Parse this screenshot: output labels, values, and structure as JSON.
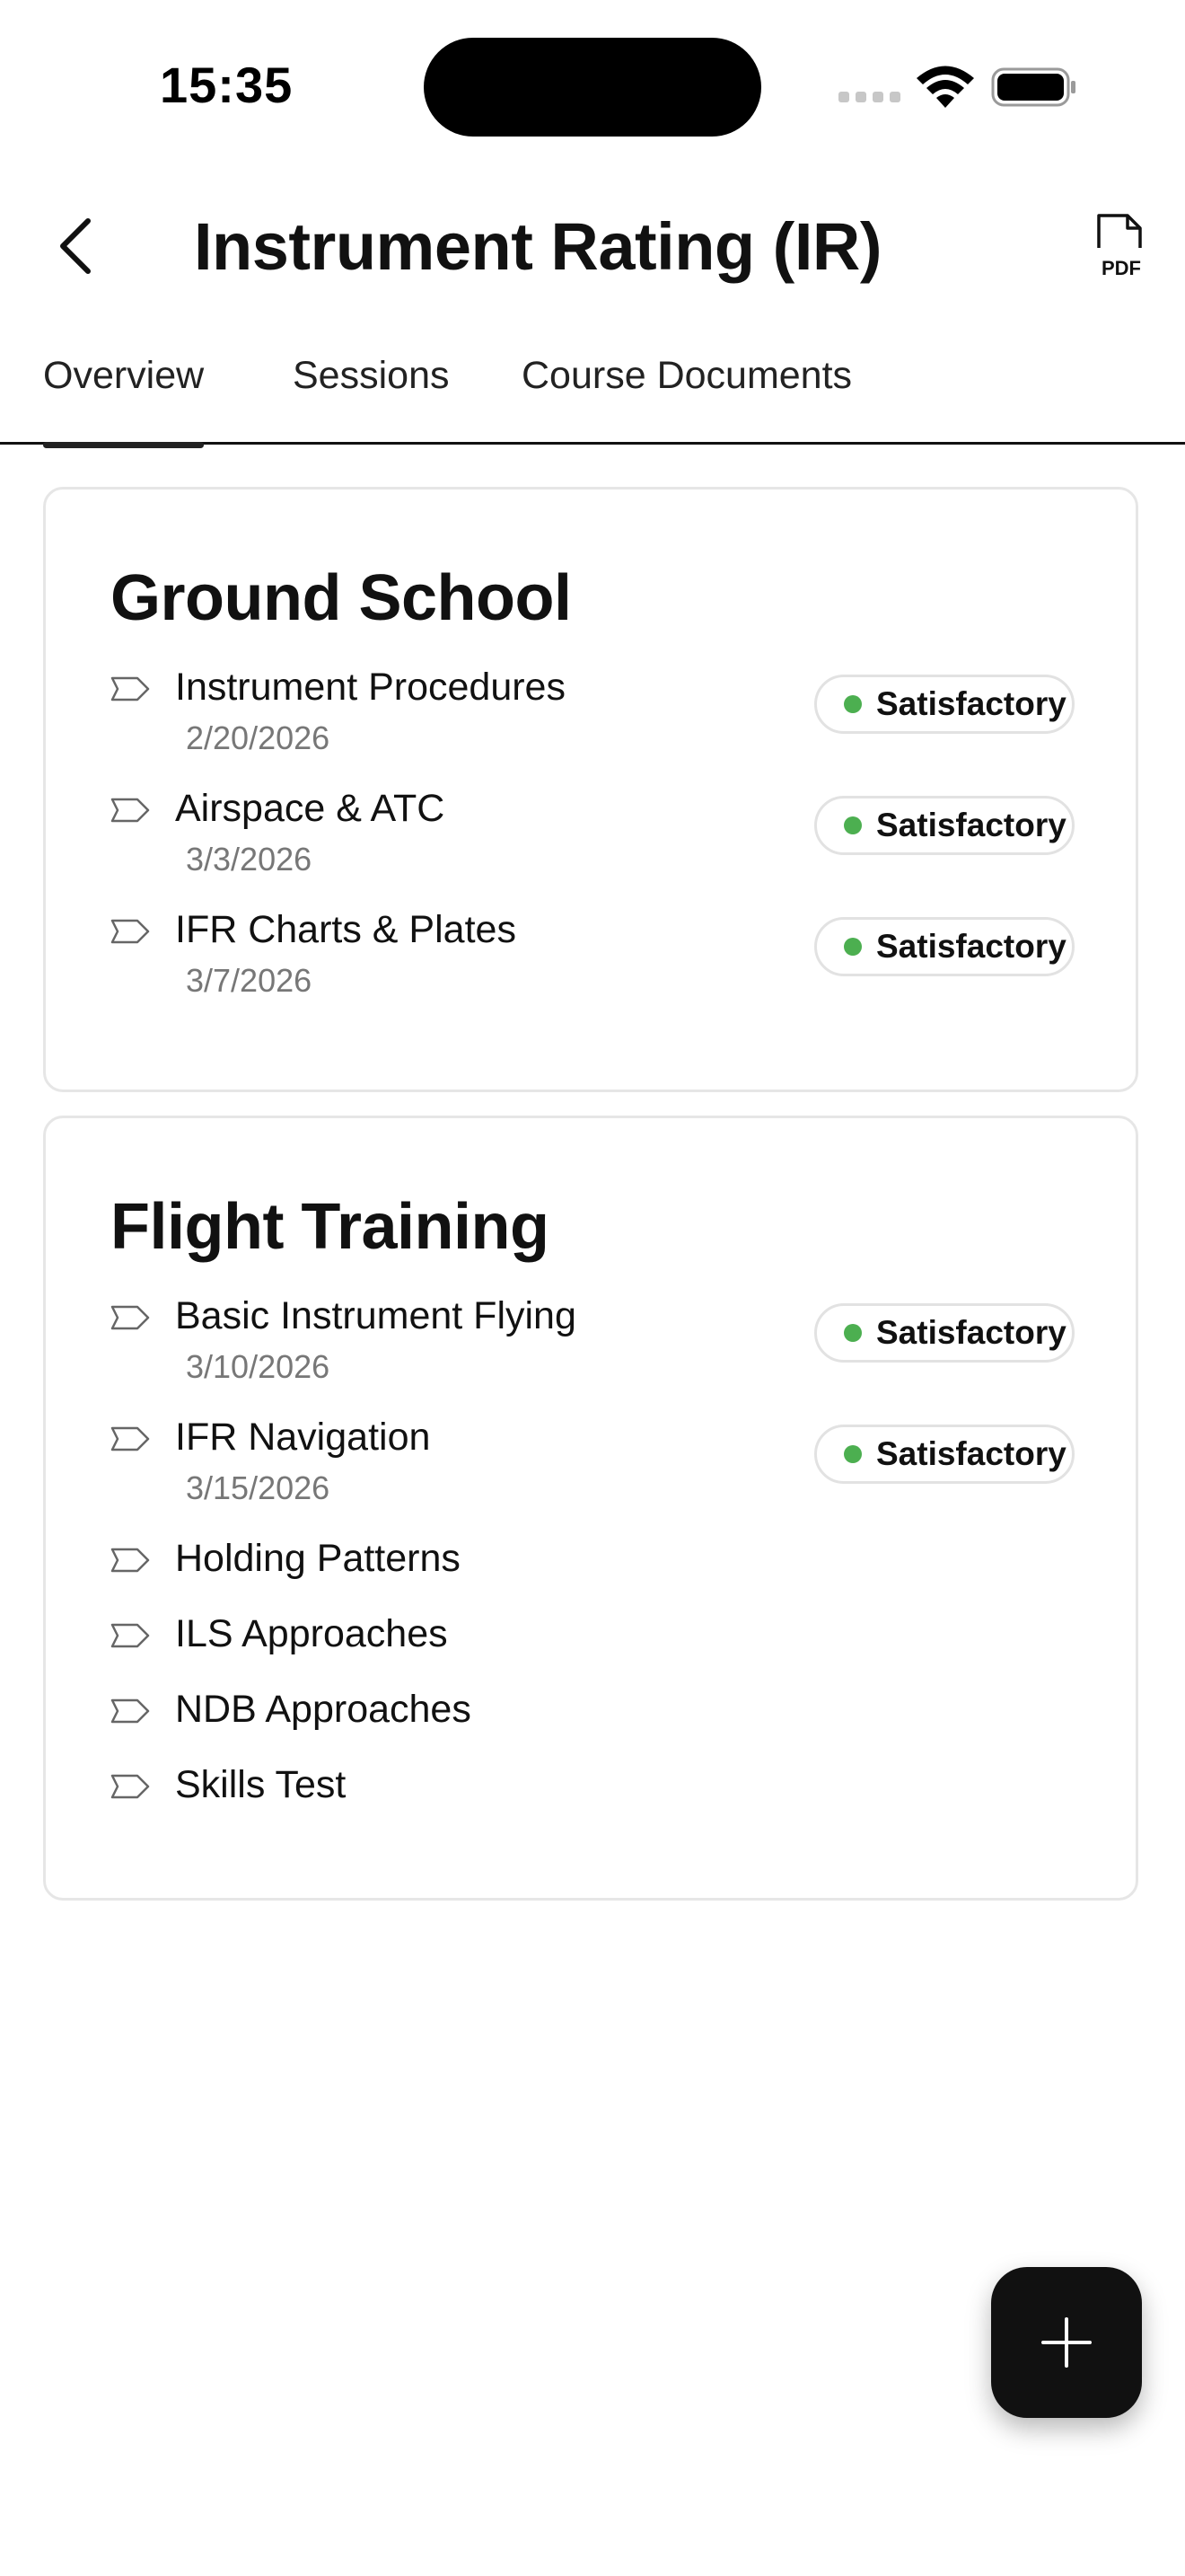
{
  "status_bar": {
    "time": "15:35"
  },
  "header": {
    "title": "Instrument Rating (IR)",
    "back_icon": "chevron-left-icon",
    "pdf_icon": "pdf-document-icon",
    "pdf_label": "PDF"
  },
  "tabs": [
    {
      "label": "Overview",
      "active": true
    },
    {
      "label": "Sessions",
      "active": false
    },
    {
      "label": "Course Documents",
      "active": false
    }
  ],
  "sections": [
    {
      "title": "Ground School",
      "lessons": [
        {
          "name": "Instrument Procedures",
          "date": "2/20/2026",
          "status": "Satisfactory"
        },
        {
          "name": "Airspace & ATC",
          "date": "3/3/2026",
          "status": "Satisfactory"
        },
        {
          "name": "IFR Charts & Plates",
          "date": "3/7/2026",
          "status": "Satisfactory"
        }
      ]
    },
    {
      "title": "Flight Training",
      "lessons": [
        {
          "name": "Basic Instrument Flying",
          "date": "3/10/2026",
          "status": "Satisfactory"
        },
        {
          "name": "IFR Navigation",
          "date": "3/15/2026",
          "status": "Satisfactory"
        },
        {
          "name": "Holding Patterns",
          "date": "",
          "status": ""
        },
        {
          "name": "ILS Approaches",
          "date": "",
          "status": ""
        },
        {
          "name": "NDB Approaches",
          "date": "",
          "status": ""
        },
        {
          "name": "Skills Test",
          "date": "",
          "status": ""
        }
      ]
    }
  ],
  "colors": {
    "satisfactory_dot": "#4caf50",
    "accent": "#111111"
  },
  "fab": {
    "icon": "plus-icon"
  }
}
